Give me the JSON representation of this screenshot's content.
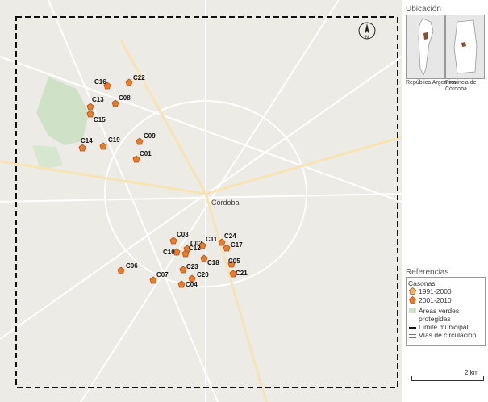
{
  "map": {
    "city_label": "Córdoba",
    "colors": {
      "background": "#ecebe6",
      "green_areas": "#cfe1c7",
      "marker_fill": "#ea7a2c",
      "marker_stroke": "#b85410",
      "marker_old_fill": "#f3b36a",
      "boundary": "#111111",
      "roads": "#ffffff"
    },
    "icons": [
      "north-arrow-icon",
      "pentagon-marker-icon"
    ],
    "markers": [
      {
        "id": "C22"
      },
      {
        "id": "C16"
      },
      {
        "id": "C08"
      },
      {
        "id": "C13"
      },
      {
        "id": "C15"
      },
      {
        "id": "C09"
      },
      {
        "id": "C14"
      },
      {
        "id": "C19"
      },
      {
        "id": "C01"
      },
      {
        "id": "C03"
      },
      {
        "id": "C02"
      },
      {
        "id": "C11"
      },
      {
        "id": "C24"
      },
      {
        "id": "C12"
      },
      {
        "id": "C17"
      },
      {
        "id": "C10"
      },
      {
        "id": "C18"
      },
      {
        "id": "C05"
      },
      {
        "id": "C23"
      },
      {
        "id": "C21"
      },
      {
        "id": "C06"
      },
      {
        "id": "C20"
      },
      {
        "id": "C07"
      },
      {
        "id": "C04"
      }
    ]
  },
  "location": {
    "title": "Ubicación",
    "inset_argentina": "República Argentina",
    "inset_cordoba": "Provincia de Córdoba"
  },
  "legend": {
    "title": "Referencias",
    "casonas_label": "Casonas",
    "period_1": "1991-2000",
    "period_2": "2001-2010",
    "green_areas": "Áreas verdes protegidas",
    "municipal_limit": "Límite municipal",
    "roads": "Vías de circulación"
  },
  "scale": {
    "label": "2 km"
  }
}
